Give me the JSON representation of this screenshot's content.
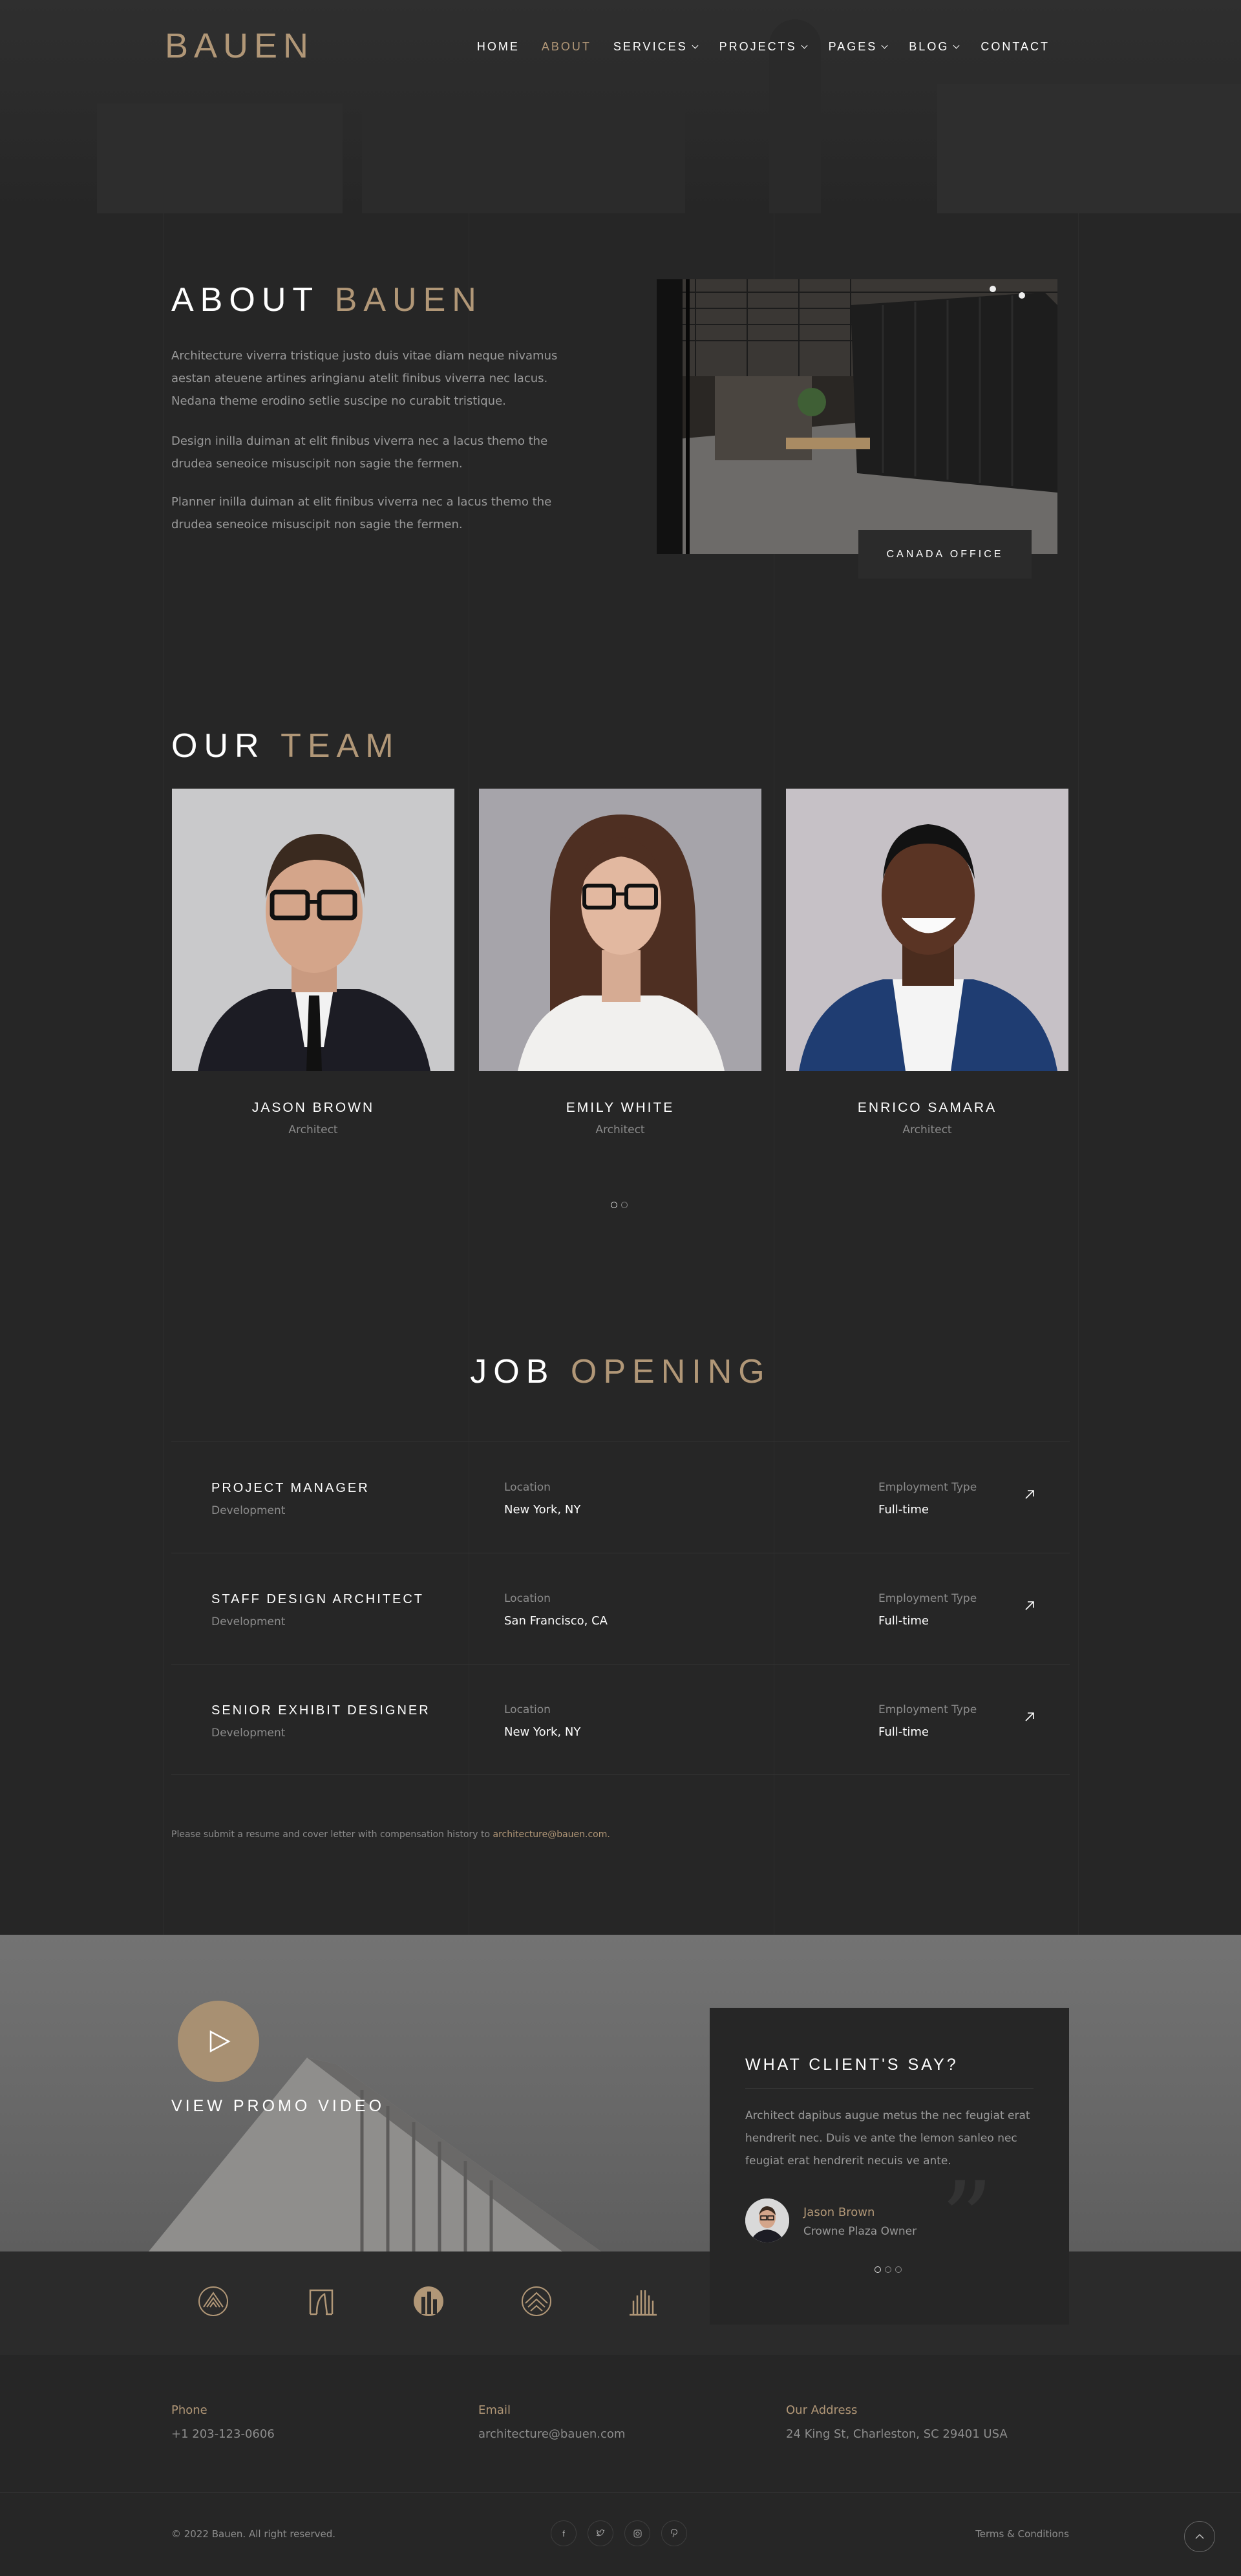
{
  "header": {
    "logo": "BAUEN",
    "nav": [
      {
        "label": "HOME",
        "active": false,
        "dropdown": false
      },
      {
        "label": "ABOUT",
        "active": true,
        "dropdown": false
      },
      {
        "label": "SERVICES",
        "active": false,
        "dropdown": true
      },
      {
        "label": "PROJECTS",
        "active": false,
        "dropdown": true
      },
      {
        "label": "PAGES",
        "active": false,
        "dropdown": true
      },
      {
        "label": "BLOG",
        "active": false,
        "dropdown": true
      },
      {
        "label": "CONTACT",
        "active": false,
        "dropdown": false
      }
    ]
  },
  "about": {
    "title_white": "ABOUT",
    "title_gold": "BAUEN",
    "paragraphs": [
      "Architecture viverra tristique justo duis vitae diam neque nivamus aestan ateuene artines aringianu atelit finibus viverra nec lacus. Nedana theme erodino setlie suscipe no curabit tristique.",
      "Design inilla duiman at elit finibus viverra nec a lacus themo the drudea seneoice misuscipit non sagie the fermen.",
      "Planner inilla duiman at elit finibus viverra nec a lacus themo the drudea seneoice misuscipit non sagie the fermen."
    ],
    "image_tag": "CANADA OFFICE"
  },
  "team": {
    "title_white": "OUR",
    "title_gold": "TEAM",
    "members": [
      {
        "name": "JASON BROWN",
        "role": "Architect"
      },
      {
        "name": "EMILY WHITE",
        "role": "Architect"
      },
      {
        "name": "ENRICO SAMARA",
        "role": "Architect"
      }
    ]
  },
  "jobs": {
    "title_white": "JOB",
    "title_gold": "OPENING",
    "location_label": "Location",
    "type_label": "Employment Type",
    "rows": [
      {
        "title": "PROJECT MANAGER",
        "dept": "Development",
        "location": "New York,  NY",
        "type": "Full-time"
      },
      {
        "title": "STAFF DESIGN ARCHITECT",
        "dept": "Development",
        "location": "San  Francisco, CA",
        "type": "Full-time"
      },
      {
        "title": "SENIOR EXHIBIT DESIGNER",
        "dept": "Development",
        "location": "New York,  NY",
        "type": "Full-time"
      }
    ],
    "note_text": "Please submit a resume and cover letter with compensation history to",
    "note_email": "architecture@bauen.com."
  },
  "promo": {
    "label": "VIEW PROMO VIDEO"
  },
  "testimonial": {
    "title": "WHAT CLIENT'S SAY?",
    "text": "Architect dapibus augue metus the nec feugiat erat hendrerit nec. Duis ve ante the lemon sanleo nec feugiat erat hendrerit necuis ve ante.",
    "name": "Jason  Brown",
    "role": "Crowne  Plaza Owner"
  },
  "footer": {
    "phone_label": "Phone",
    "phone": "+1 203-123-0606",
    "email_label": "Email",
    "email": "architecture@bauen.com",
    "address_label": "Our Address",
    "address": "24  King St, Charleston, SC 29401 USA",
    "copyright": "© 2022  Bauen. All right reserved.",
    "terms": "Terms & Conditions",
    "social": [
      "facebook-icon",
      "twitter-icon",
      "instagram-icon",
      "pinterest-icon"
    ]
  },
  "colors": {
    "accent": "#b19777",
    "background": "#262626"
  }
}
